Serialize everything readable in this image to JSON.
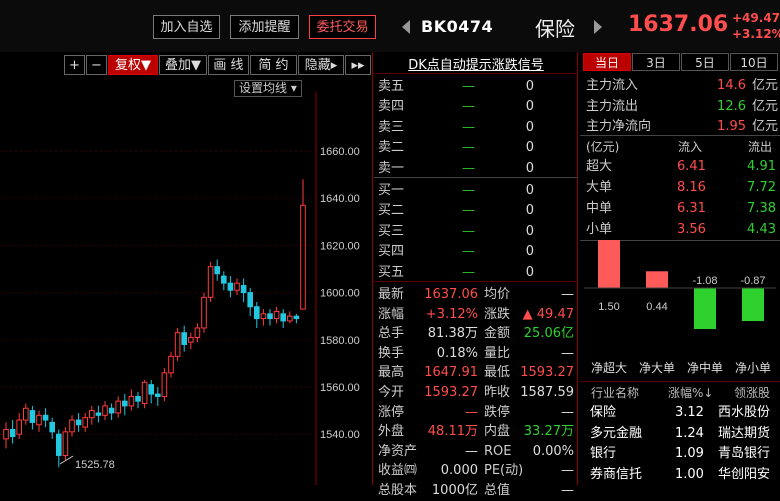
{
  "header": {
    "buttons": [
      "加入自选",
      "添加提醒",
      "委托交易"
    ],
    "code": "BK0474",
    "name": "保险",
    "price": "1637.06",
    "change": "+49.47",
    "change_pct": "+3.12%"
  },
  "toolbar": {
    "items": [
      "+",
      "−",
      "复权▼",
      "叠加▼",
      "画 线",
      "简 约",
      "隐藏▸",
      "▸▸"
    ],
    "ma_setting": "设置均线"
  },
  "chart": {
    "ticks": [
      "1660.00",
      "1640.00",
      "1620.00",
      "1600.00",
      "1580.00",
      "1560.00",
      "1540.00"
    ],
    "low_label": "1525.78"
  },
  "orderbook": {
    "title": "DK点自动提示涨跌信号",
    "sells": [
      {
        "label": "卖五",
        "vol": "0"
      },
      {
        "label": "卖四",
        "vol": "0"
      },
      {
        "label": "卖三",
        "vol": "0"
      },
      {
        "label": "卖二",
        "vol": "0"
      },
      {
        "label": "卖一",
        "vol": "0"
      }
    ],
    "buys": [
      {
        "label": "买一",
        "vol": "0"
      },
      {
        "label": "买二",
        "vol": "0"
      },
      {
        "label": "买三",
        "vol": "0"
      },
      {
        "label": "买四",
        "vol": "0"
      },
      {
        "label": "买五",
        "vol": "0"
      }
    ],
    "dash": "—",
    "stats": [
      {
        "k1": "最新",
        "v1": "1637.06",
        "k2": "均价",
        "v2": "—"
      },
      {
        "k1": "涨幅",
        "v1": "+3.12%",
        "k2": "涨跌",
        "v2": "▲ 49.47"
      },
      {
        "k1": "总手",
        "v1": "81.38万",
        "k2": "金额",
        "v2": "25.06亿"
      },
      {
        "k1": "换手",
        "v1": "0.18%",
        "k2": "量比",
        "v2": "—"
      },
      {
        "k1": "最高",
        "v1": "1647.91",
        "k2": "最低",
        "v2": "1593.27"
      },
      {
        "k1": "今开",
        "v1": "1593.27",
        "k2": "昨收",
        "v2": "1587.59"
      },
      {
        "k1": "涨停",
        "v1": "—",
        "k2": "跌停",
        "v2": "—"
      },
      {
        "k1": "外盘",
        "v1": "48.11万",
        "k2": "内盘",
        "v2": "33.27万"
      },
      {
        "k1": "净资产",
        "v1": "—",
        "k2": "ROE",
        "v2": "0.00%"
      },
      {
        "k1": "收益㈣",
        "v1": "0.000",
        "k2": "PE(动)",
        "v2": "—"
      },
      {
        "k1": "总股本",
        "v1": "1000亿",
        "k2": "总值",
        "v2": "—"
      }
    ]
  },
  "flows": {
    "tabs": [
      "当日",
      "3日",
      "5日",
      "10日"
    ],
    "main": [
      {
        "label": "主力流入",
        "value": "14.6",
        "unit": "亿元"
      },
      {
        "label": "主力流出",
        "value": "12.6",
        "unit": "亿元"
      },
      {
        "label": "主力净流向",
        "value": "1.95",
        "unit": "亿元"
      }
    ],
    "table_header": [
      "(亿元)",
      "流入",
      "流出"
    ],
    "rows": [
      {
        "label": "超大",
        "in": "6.41",
        "out": "4.91"
      },
      {
        "label": "大单",
        "in": "8.16",
        "out": "7.72"
      },
      {
        "label": "中单",
        "in": "6.31",
        "out": "7.38"
      },
      {
        "label": "小单",
        "in": "3.56",
        "out": "4.43"
      }
    ],
    "net_values": [
      1.5,
      0.44,
      -1.08,
      -0.87
    ],
    "net_labels": [
      "1.50",
      "0.44",
      "-1.08",
      "-0.87"
    ],
    "bar_names": [
      "净超大",
      "净大单",
      "净中单",
      "净小单"
    ]
  },
  "sectors": {
    "header": [
      "行业名称",
      "涨幅%↓",
      "领涨股"
    ],
    "rows": [
      {
        "name": "保险",
        "pct": "3.12",
        "leader": "西水股份"
      },
      {
        "name": "多元金融",
        "pct": "1.24",
        "leader": "瑞达期货"
      },
      {
        "name": "银行",
        "pct": "1.09",
        "leader": "青岛银行"
      },
      {
        "name": "券商信托",
        "pct": "1.00",
        "leader": "华创阳安"
      }
    ]
  },
  "colors": {
    "up": "#ff4d4d",
    "down": "#2fd12f",
    "accent": "#b00000"
  }
}
